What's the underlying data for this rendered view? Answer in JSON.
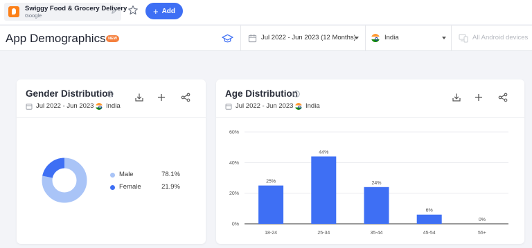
{
  "app": {
    "name": "Swiggy Food & Grocery Delivery",
    "developer": "Google",
    "add_label": "Add"
  },
  "header": {
    "title": "App Demographics",
    "badge": "NEW",
    "date_range": "Jul 2022 - Jun 2023 (12 Months)",
    "country": "India",
    "device": "All Android devices"
  },
  "gender_card": {
    "title": "Gender Distribution",
    "date": "Jul 2022 - Jun 2023",
    "country": "India",
    "legend": [
      {
        "label": "Male",
        "value": "78.1%",
        "color": "#a9c4f7"
      },
      {
        "label": "Female",
        "value": "21.9%",
        "color": "#3e6ff4"
      }
    ]
  },
  "age_card": {
    "title": "Age Distribution",
    "date": "Jul 2022 - Jun 2023",
    "country": "India"
  },
  "colors": {
    "accent": "#3e6ff4",
    "badge": "#f5803e",
    "male": "#a9c4f7",
    "female": "#3e6ff4"
  },
  "chart_data": [
    {
      "type": "pie",
      "title": "Gender Distribution",
      "categories": [
        "Male",
        "Female"
      ],
      "values": [
        78.1,
        21.9
      ]
    },
    {
      "type": "bar",
      "title": "Age Distribution",
      "categories": [
        "18-24",
        "25-34",
        "35-44",
        "45-54",
        "55+"
      ],
      "values": [
        25,
        44,
        24,
        6,
        0
      ],
      "labels": [
        "25%",
        "44%",
        "24%",
        "6%",
        "0%"
      ],
      "yticks": [
        "0%",
        "20%",
        "40%",
        "60%"
      ],
      "ylim": [
        0,
        60
      ],
      "grid": true
    }
  ]
}
